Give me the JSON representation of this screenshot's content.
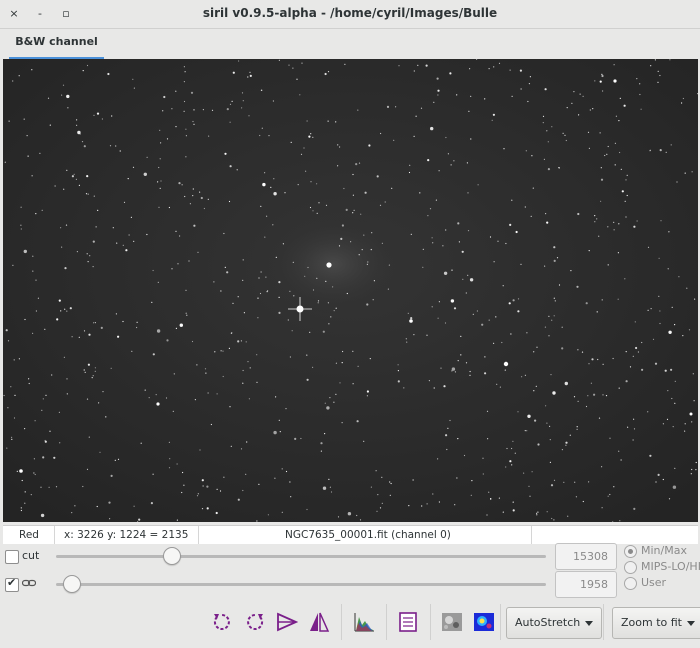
{
  "window": {
    "title": "siril v0.9.5-alpha - /home/cyril/Images/Bulle",
    "close_glyph": "×",
    "minimize_glyph": "-",
    "maximize_glyph": "▫"
  },
  "tabs": [
    {
      "label": "B&W channel",
      "active": true
    }
  ],
  "status": {
    "channel": "Red",
    "coords": "x: 3226 y: 1224 = 2135",
    "filename": "NGC7635_00001.fit (channel 0)"
  },
  "cut": {
    "label": "cut",
    "checked": false,
    "slider_fraction": 0.235,
    "value": "15308"
  },
  "link": {
    "checked": true,
    "icon": "chain-link-icon",
    "slider_fraction": 0.03,
    "value": "1958"
  },
  "scale_modes": [
    {
      "label": "Min/Max",
      "selected": true
    },
    {
      "label": "MIPS-LO/HI",
      "selected": false
    },
    {
      "label": "User",
      "selected": false
    }
  ],
  "toolbar": {
    "autostretch_label": "AutoStretch",
    "zoom_label": "Zoom to fit",
    "accent_color": "#7a1f8a"
  }
}
